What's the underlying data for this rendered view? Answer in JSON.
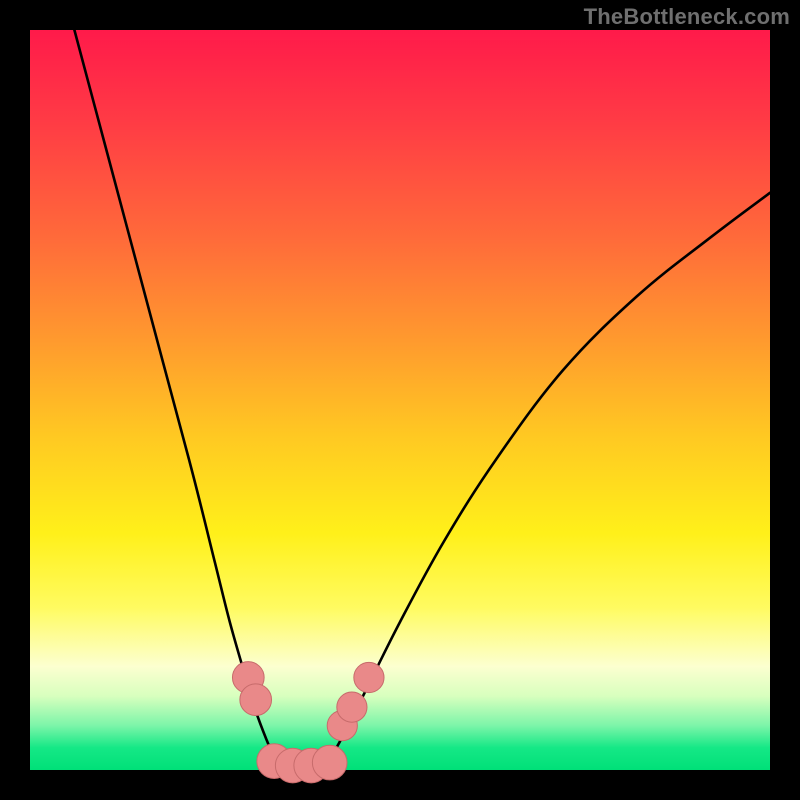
{
  "watermark": "TheBottleneck.com",
  "colors": {
    "background": "#000000",
    "watermark": "#6f6f6f",
    "curve": "#000000",
    "markers_fill": "#e98989",
    "markers_stroke": "#c76b6b",
    "gradient_top": "#ff1a4a",
    "gradient_bottom": "#00e078"
  },
  "chart_data": {
    "type": "line",
    "title": "",
    "xlabel": "",
    "ylabel": "",
    "xlim": [
      0,
      100
    ],
    "ylim": [
      0,
      100
    ],
    "series": [
      {
        "name": "left-bottleneck-curve",
        "x": [
          6,
          10,
          14,
          18,
          22,
          25,
          27,
          29,
          30.5,
          32,
          33.5
        ],
        "y": [
          100,
          85,
          70,
          55,
          40,
          28,
          20,
          13,
          8,
          4,
          0.5
        ]
      },
      {
        "name": "right-bottleneck-curve",
        "x": [
          40,
          42.5,
          45,
          50,
          56,
          63,
          72,
          82,
          92,
          100
        ],
        "y": [
          0.5,
          5,
          10,
          20,
          31,
          42,
          54,
          64,
          72,
          78
        ]
      },
      {
        "name": "valley-floor",
        "x": [
          32,
          34,
          36,
          38,
          40,
          41
        ],
        "y": [
          1.5,
          0.5,
          0.5,
          0.5,
          0.5,
          1.2
        ]
      }
    ],
    "markers": [
      {
        "name": "left-marker-upper",
        "x": 29.5,
        "y": 12.5,
        "r": 1.6
      },
      {
        "name": "left-marker-lower",
        "x": 30.5,
        "y": 9.5,
        "r": 1.6
      },
      {
        "name": "right-marker-lower",
        "x": 42.2,
        "y": 6.0,
        "r": 1.5
      },
      {
        "name": "right-marker-mid",
        "x": 43.5,
        "y": 8.5,
        "r": 1.5
      },
      {
        "name": "right-marker-upper",
        "x": 45.8,
        "y": 12.5,
        "r": 1.5
      },
      {
        "name": "floor-marker-a",
        "x": 33.0,
        "y": 1.2,
        "r": 1.8
      },
      {
        "name": "floor-marker-b",
        "x": 35.5,
        "y": 0.6,
        "r": 1.8
      },
      {
        "name": "floor-marker-c",
        "x": 38.0,
        "y": 0.6,
        "r": 1.8
      },
      {
        "name": "floor-marker-d",
        "x": 40.5,
        "y": 1.0,
        "r": 1.8
      }
    ]
  }
}
